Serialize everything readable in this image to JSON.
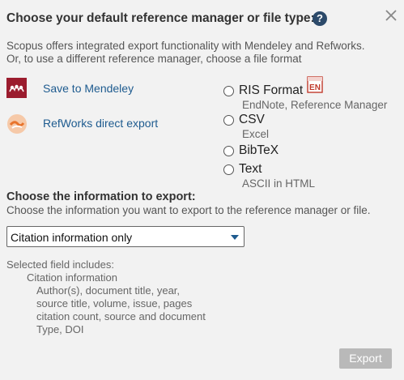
{
  "dialog": {
    "title": "Choose your default reference manager or file type:",
    "help_glyph": "?",
    "intro_line1": "Scopus offers integrated export functionality with Mendeley and Refworks.",
    "intro_line2": "Or, to use a different reference manager, choose a file format"
  },
  "managers": {
    "mendeley_label": "Save to Mendeley",
    "refworks_label": "RefWorks direct export"
  },
  "formats": [
    {
      "label": "RIS Format",
      "sub": "EndNote, Reference Manager",
      "selected": false
    },
    {
      "label": "CSV",
      "sub": "Excel",
      "selected": false
    },
    {
      "label": "BibTeX",
      "sub": "",
      "selected": false
    },
    {
      "label": "Text",
      "sub": "ASCII in HTML",
      "selected": false
    }
  ],
  "info": {
    "title": "Choose the information to export:",
    "desc": "Choose the information you want to export to the reference manager or file.",
    "select_value": "Citation information only"
  },
  "includes": {
    "heading": "Selected field includes:",
    "group": "Citation information",
    "lines": [
      "Author(s), document title, year,",
      "source title, volume, issue, pages",
      "citation count, source and document",
      "Type, DOI"
    ]
  },
  "actions": {
    "export_label": "Export",
    "export_enabled": false
  },
  "colors": {
    "link": "#1e5b8f",
    "help_icon": "#2c4a6a",
    "mendeley_brand": "#9b1c2e",
    "refworks_brand": "#e8742c",
    "disabled_button": "#b9b9b9"
  }
}
